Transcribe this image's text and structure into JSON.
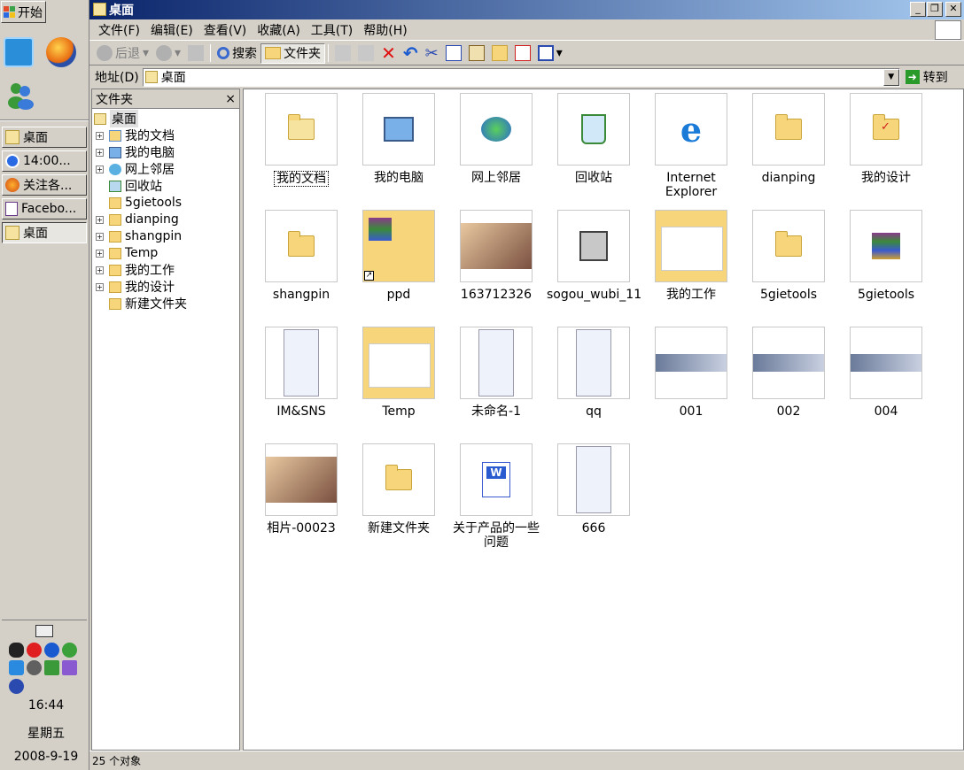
{
  "taskbar": {
    "start_label": "开始",
    "tasks": [
      {
        "label": "桌面"
      },
      {
        "label": "14:00..."
      },
      {
        "label": "关注各..."
      },
      {
        "label": "Facebo..."
      },
      {
        "label": "桌面"
      }
    ],
    "clock": {
      "time": "16:44",
      "weekday": "星期五",
      "date": "2008-9-19"
    }
  },
  "window": {
    "title": "桌面",
    "menu": [
      "文件(F)",
      "编辑(E)",
      "查看(V)",
      "收藏(A)",
      "工具(T)",
      "帮助(H)"
    ],
    "toolbar": {
      "back": "后退",
      "search": "搜索",
      "folders": "文件夹"
    },
    "address": {
      "label": "地址(D)",
      "value": "桌面",
      "go": "转到"
    },
    "folder_pane": {
      "title": "文件夹",
      "close": "×",
      "tree": [
        "桌面",
        "我的文档",
        "我的电脑",
        "网上邻居",
        "回收站",
        "5gietools",
        "dianping",
        "shangpin",
        "Temp",
        "我的工作",
        "我的设计",
        "新建文件夹"
      ]
    },
    "items": [
      {
        "label": "我的文档",
        "icon": "my-documents-icon"
      },
      {
        "label": "我的电脑",
        "icon": "my-computer-icon"
      },
      {
        "label": "网上邻居",
        "icon": "network-icon"
      },
      {
        "label": "回收站",
        "icon": "recycle-bin-icon"
      },
      {
        "label": "Internet Explorer",
        "icon": "ie-icon"
      },
      {
        "label": "dianping",
        "icon": "folder-icon"
      },
      {
        "label": "我的设计",
        "icon": "folder-check-icon"
      },
      {
        "label": "shangpin",
        "icon": "folder-icon"
      },
      {
        "label": "ppd",
        "icon": "folder-shortcut-icon"
      },
      {
        "label": "163712326",
        "icon": "photo-thumbnail"
      },
      {
        "label": "sogou_wubi_11",
        "icon": "installer-icon"
      },
      {
        "label": "我的工作",
        "icon": "folder-thumbnail"
      },
      {
        "label": "5gietools",
        "icon": "folder-icon"
      },
      {
        "label": "5gietools",
        "icon": "winrar-icon"
      },
      {
        "label": "IM&SNS",
        "icon": "screenshot-thumbnail"
      },
      {
        "label": "Temp",
        "icon": "folder-thumbnail"
      },
      {
        "label": "未命名-1",
        "icon": "screenshot-thumbnail"
      },
      {
        "label": "qq",
        "icon": "screenshot-thumbnail"
      },
      {
        "label": "001",
        "icon": "image-thumbnail"
      },
      {
        "label": "002",
        "icon": "image-thumbnail"
      },
      {
        "label": "004",
        "icon": "image-thumbnail"
      },
      {
        "label": "相片-00023",
        "icon": "photo-thumbnail"
      },
      {
        "label": "新建文件夹",
        "icon": "folder-icon"
      },
      {
        "label": "关于产品的一些问题",
        "icon": "word-doc-icon"
      },
      {
        "label": "666",
        "icon": "screenshot-thumbnail"
      }
    ],
    "status": "25 个对象"
  }
}
